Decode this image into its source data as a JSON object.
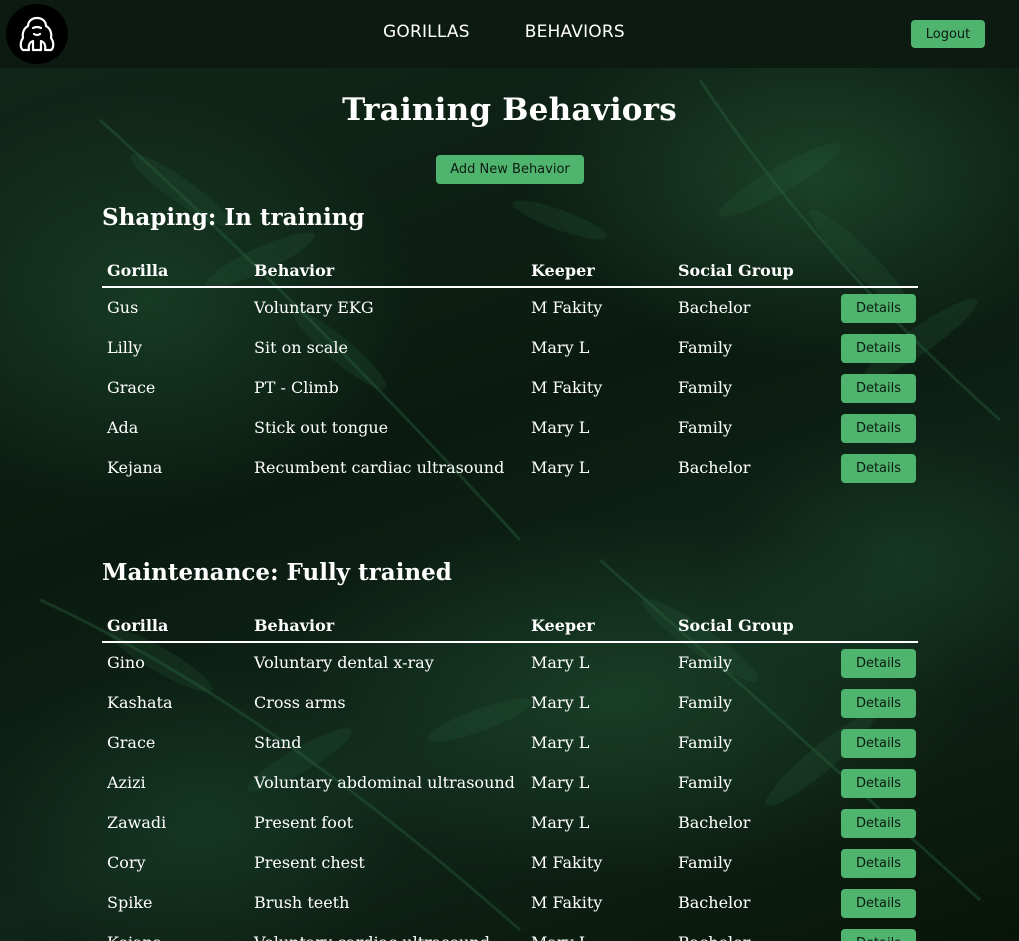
{
  "nav": {
    "logo_icon": "gorilla-icon",
    "links": [
      "GORILLAS",
      "BEHAVIORS"
    ],
    "logout_label": "Logout"
  },
  "page": {
    "title": "Training Behaviors",
    "add_label": "Add New Behavior"
  },
  "columns": [
    "Gorilla",
    "Behavior",
    "Keeper",
    "Social Group"
  ],
  "details_label": "Details",
  "sections": [
    {
      "title": "Shaping: In training",
      "rows": [
        {
          "gorilla": "Gus",
          "behavior": "Voluntary EKG",
          "keeper": "M Fakity",
          "group": "Bachelor"
        },
        {
          "gorilla": "Lilly",
          "behavior": "Sit on scale",
          "keeper": "Mary L",
          "group": "Family"
        },
        {
          "gorilla": "Grace",
          "behavior": "PT - Climb",
          "keeper": "M Fakity",
          "group": "Family"
        },
        {
          "gorilla": "Ada",
          "behavior": "Stick out tongue",
          "keeper": "Mary L",
          "group": "Family"
        },
        {
          "gorilla": "Kejana",
          "behavior": "Recumbent cardiac ultrasound",
          "keeper": "Mary L",
          "group": "Bachelor"
        }
      ]
    },
    {
      "title": "Maintenance: Fully trained",
      "rows": [
        {
          "gorilla": "Gino",
          "behavior": "Voluntary dental x-ray",
          "keeper": "Mary L",
          "group": "Family"
        },
        {
          "gorilla": "Kashata",
          "behavior": "Cross arms",
          "keeper": "Mary L",
          "group": "Family"
        },
        {
          "gorilla": "Grace",
          "behavior": "Stand",
          "keeper": "Mary L",
          "group": "Family"
        },
        {
          "gorilla": "Azizi",
          "behavior": "Voluntary abdominal ultrasound",
          "keeper": "Mary L",
          "group": "Family"
        },
        {
          "gorilla": "Zawadi",
          "behavior": "Present foot",
          "keeper": "Mary L",
          "group": "Bachelor"
        },
        {
          "gorilla": "Cory",
          "behavior": "Present chest",
          "keeper": "M Fakity",
          "group": "Family"
        },
        {
          "gorilla": "Spike",
          "behavior": "Brush teeth",
          "keeper": "M Fakity",
          "group": "Bachelor"
        },
        {
          "gorilla": "Kejana",
          "behavior": "Voluntary cardiac ultrasound",
          "keeper": "Mary L",
          "group": "Bachelor"
        }
      ]
    }
  ],
  "colors": {
    "accent": "#4fb56e",
    "navbar": "#0c1a12"
  }
}
